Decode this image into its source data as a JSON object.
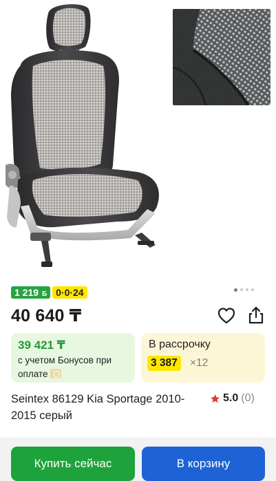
{
  "product": {
    "bonus_badge": "1 219",
    "bonus_badge_symbol": "Б",
    "installment_badge": "0·0·24",
    "price": "40 640 ₸",
    "title": "Seintex 86129 Kia Sportage 2010-2015 серый",
    "rating": "5.0",
    "reviews_count": "(0)"
  },
  "bonus_offer": {
    "price": "39 421 ₸",
    "note": "с учетом Бонусов при оплате"
  },
  "installment_offer": {
    "label": "В рассрочку",
    "monthly_amount": "3 387",
    "months": "×12"
  },
  "actions": {
    "buy_now": "Купить сейчас",
    "add_to_cart": "В корзину"
  },
  "gallery": {
    "slides": 4,
    "active_slide": 1
  },
  "icons": {
    "favorite": "heart-icon",
    "share": "share-icon",
    "rating": "star-icon",
    "bonus": "bonus-wallet-icon"
  },
  "colors": {
    "bonus_green": "#26a342",
    "installment_yellow": "#ffe600",
    "buy_button": "#1ea33c",
    "cart_button": "#1d63d6",
    "star": "#e53935"
  }
}
